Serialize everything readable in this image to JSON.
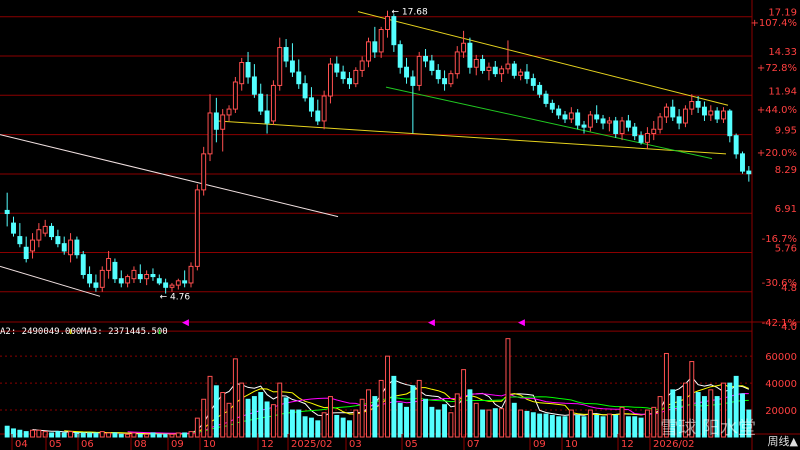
{
  "colors": {
    "up": "#ff5050",
    "down": "#54ffff",
    "grid": "#8b0000",
    "price_label": "#ff4040",
    "ma_colors": [
      "#ffffff",
      "#ffff00",
      "#ff00ff",
      "#00ff00"
    ],
    "trend_upper": "#e6d21e",
    "trend_lower": "#21c821",
    "trend_left": "#f0e0e0"
  },
  "labels": {
    "ma_readout_a": "A2: 2490049.000",
    "ma_readout_b": "MA3: 2371445.500",
    "arrow_a": "↓",
    "arrow_b": "↓",
    "high_marker": "17.68",
    "low_marker": "4.76",
    "watermark": "雪球 阳水堂",
    "period_button": "周线▲"
  },
  "chart_data": [
    {
      "type": "candlestick",
      "price_ticks": [
        17.19,
        14.33,
        11.94,
        9.95,
        8.29,
        6.91,
        5.76,
        4.8,
        4.0
      ],
      "percent_ticks": [
        "+107.4%",
        "+72.8%",
        "+44.0%",
        "+20.0%",
        "-16.7%",
        "-30.6%",
        "-42.1%"
      ],
      "x_ticks": [
        "04",
        "05",
        "06",
        "08",
        "09",
        "10",
        "12",
        "2025/02",
        "03",
        "05",
        "07",
        "09",
        "10",
        "12",
        "2026/02"
      ],
      "annotations": {
        "high": 17.68,
        "low": 4.76
      },
      "log_scale": true,
      "ohlc": [
        [
          7.0,
          7.6,
          6.5,
          6.9
        ],
        [
          6.6,
          6.8,
          6.2,
          6.3
        ],
        [
          6.2,
          6.6,
          5.9,
          6.0
        ],
        [
          5.9,
          6.2,
          5.5,
          5.6
        ],
        [
          5.8,
          6.3,
          5.6,
          6.1
        ],
        [
          6.1,
          6.6,
          5.9,
          6.4
        ],
        [
          6.3,
          6.7,
          6.2,
          6.5
        ],
        [
          6.5,
          6.6,
          6.1,
          6.2
        ],
        [
          6.2,
          6.4,
          5.9,
          6.0
        ],
        [
          6.0,
          6.2,
          5.7,
          5.8
        ],
        [
          5.7,
          6.3,
          5.5,
          6.1
        ],
        [
          6.1,
          6.2,
          5.6,
          5.7
        ],
        [
          5.7,
          5.8,
          5.1,
          5.2
        ],
        [
          5.2,
          5.4,
          4.9,
          5.0
        ],
        [
          5.0,
          5.2,
          4.8,
          4.9
        ],
        [
          4.9,
          5.4,
          4.8,
          5.3
        ],
        [
          5.3,
          5.8,
          5.1,
          5.6
        ],
        [
          5.5,
          5.6,
          5.0,
          5.1
        ],
        [
          5.1,
          5.3,
          4.9,
          5.0
        ],
        [
          5.0,
          5.2,
          4.9,
          5.15
        ],
        [
          5.1,
          5.4,
          5.0,
          5.3
        ],
        [
          5.2,
          5.45,
          5.0,
          5.1
        ],
        [
          5.1,
          5.3,
          4.95,
          5.2
        ],
        [
          5.2,
          5.35,
          5.05,
          5.15
        ],
        [
          5.1,
          5.2,
          4.95,
          5.0
        ],
        [
          5.0,
          5.1,
          4.76,
          4.9
        ],
        [
          4.9,
          5.0,
          4.8,
          4.95
        ],
        [
          4.95,
          5.1,
          4.85,
          5.05
        ],
        [
          5.05,
          5.3,
          4.9,
          5.0
        ],
        [
          5.0,
          5.5,
          4.9,
          5.4
        ],
        [
          5.4,
          7.9,
          5.3,
          7.7
        ],
        [
          7.7,
          9.4,
          7.5,
          9.1
        ],
        [
          9.1,
          12.0,
          8.8,
          11.0
        ],
        [
          11.0,
          11.8,
          9.6,
          10.2
        ],
        [
          10.2,
          11.2,
          9.2,
          10.9
        ],
        [
          10.9,
          11.4,
          10.6,
          11.2
        ],
        [
          11.2,
          13.0,
          11.0,
          12.7
        ],
        [
          12.6,
          14.2,
          12.2,
          13.9
        ],
        [
          13.9,
          14.6,
          12.6,
          13.0
        ],
        [
          13.0,
          13.8,
          11.8,
          12.0
        ],
        [
          12.0,
          12.6,
          10.9,
          11.1
        ],
        [
          11.1,
          12.0,
          10.0,
          10.5
        ],
        [
          10.6,
          12.8,
          10.4,
          12.5
        ],
        [
          12.5,
          15.6,
          12.2,
          14.9
        ],
        [
          14.9,
          15.5,
          13.6,
          14.0
        ],
        [
          14.0,
          15.2,
          13.0,
          13.3
        ],
        [
          13.3,
          14.1,
          12.3,
          12.6
        ],
        [
          12.6,
          13.1,
          11.6,
          11.8
        ],
        [
          11.8,
          12.4,
          10.8,
          11.1
        ],
        [
          11.1,
          11.7,
          10.4,
          10.6
        ],
        [
          10.6,
          12.2,
          10.2,
          11.9
        ],
        [
          11.9,
          14.2,
          11.5,
          13.8
        ],
        [
          13.8,
          14.3,
          13.0,
          13.3
        ],
        [
          13.3,
          13.7,
          12.6,
          12.9
        ],
        [
          12.9,
          13.3,
          12.3,
          12.6
        ],
        [
          12.6,
          13.6,
          12.4,
          13.4
        ],
        [
          13.4,
          14.3,
          13.0,
          14.0
        ],
        [
          14.0,
          15.6,
          13.6,
          15.3
        ],
        [
          15.3,
          16.4,
          14.2,
          14.6
        ],
        [
          14.6,
          16.4,
          14.2,
          16.2
        ],
        [
          16.2,
          17.68,
          15.6,
          17.2
        ],
        [
          17.2,
          17.4,
          14.6,
          15.1
        ],
        [
          15.1,
          15.4,
          13.2,
          13.6
        ],
        [
          13.6,
          14.2,
          12.6,
          13.0
        ],
        [
          13.0,
          13.4,
          10.0,
          12.5
        ],
        [
          12.5,
          14.6,
          12.2,
          14.3
        ],
        [
          14.3,
          14.8,
          13.6,
          14.0
        ],
        [
          14.0,
          14.4,
          13.1,
          13.4
        ],
        [
          13.4,
          13.8,
          12.6,
          12.9
        ],
        [
          12.9,
          13.4,
          12.2,
          12.6
        ],
        [
          12.6,
          13.4,
          12.4,
          13.2
        ],
        [
          13.2,
          15.0,
          12.9,
          14.6
        ],
        [
          14.6,
          16.1,
          14.2,
          15.2
        ],
        [
          15.2,
          15.6,
          13.2,
          13.6
        ],
        [
          13.6,
          14.4,
          13.1,
          14.1
        ],
        [
          14.1,
          14.4,
          13.2,
          13.4
        ],
        [
          13.4,
          13.9,
          12.8,
          13.6
        ],
        [
          13.6,
          14.0,
          13.0,
          13.2
        ],
        [
          13.2,
          13.7,
          12.7,
          13.5
        ],
        [
          13.5,
          15.4,
          13.2,
          13.8
        ],
        [
          13.8,
          14.0,
          12.9,
          13.1
        ],
        [
          13.1,
          13.5,
          12.8,
          13.3
        ],
        [
          13.3,
          13.8,
          12.6,
          12.9
        ],
        [
          12.9,
          13.2,
          12.2,
          12.5
        ],
        [
          12.5,
          12.7,
          11.8,
          12.0
        ],
        [
          12.0,
          12.2,
          11.3,
          11.5
        ],
        [
          11.5,
          11.7,
          11.0,
          11.2
        ],
        [
          11.2,
          11.4,
          10.7,
          10.9
        ],
        [
          10.9,
          11.1,
          10.5,
          10.7
        ],
        [
          10.7,
          11.3,
          10.5,
          11.0
        ],
        [
          11.0,
          11.2,
          10.2,
          10.4
        ],
        [
          10.4,
          10.6,
          10.0,
          10.3
        ],
        [
          10.3,
          11.1,
          10.1,
          10.9
        ],
        [
          10.9,
          11.4,
          10.5,
          10.7
        ],
        [
          10.7,
          10.9,
          10.2,
          10.5
        ],
        [
          10.5,
          10.8,
          10.1,
          10.6
        ],
        [
          10.6,
          10.8,
          9.8,
          10.0
        ],
        [
          10.0,
          10.8,
          9.7,
          10.6
        ],
        [
          10.6,
          10.9,
          10.1,
          10.3
        ],
        [
          10.3,
          10.5,
          9.7,
          9.9
        ],
        [
          9.9,
          10.1,
          9.5,
          9.6
        ],
        [
          9.6,
          10.3,
          9.3,
          10.0
        ],
        [
          10.0,
          10.6,
          9.7,
          10.2
        ],
        [
          10.2,
          11.0,
          10.0,
          10.8
        ],
        [
          10.8,
          11.5,
          10.5,
          11.3
        ],
        [
          11.3,
          11.7,
          10.6,
          10.8
        ],
        [
          10.8,
          11.2,
          10.2,
          10.5
        ],
        [
          10.5,
          11.4,
          10.3,
          11.2
        ],
        [
          11.2,
          12.0,
          10.9,
          11.6
        ],
        [
          11.6,
          11.9,
          11.0,
          11.3
        ],
        [
          11.3,
          11.6,
          10.6,
          10.9
        ],
        [
          10.9,
          11.4,
          10.6,
          11.1
        ],
        [
          11.1,
          11.3,
          10.5,
          10.7
        ],
        [
          10.7,
          11.3,
          10.5,
          11.1
        ],
        [
          11.1,
          11.2,
          9.6,
          9.9
        ],
        [
          9.9,
          10.0,
          8.9,
          9.1
        ],
        [
          9.1,
          9.2,
          8.3,
          8.4
        ],
        [
          8.4,
          8.6,
          8.0,
          8.3
        ]
      ]
    },
    {
      "type": "bar",
      "y_ticks": [
        20000,
        40000,
        60000
      ],
      "series": [
        {
          "name": "A2",
          "values": []
        },
        {
          "name": "MA3",
          "values": []
        }
      ],
      "values": [
        8,
        6,
        5,
        4,
        5,
        5,
        4,
        3,
        4,
        3,
        4,
        3,
        3,
        3,
        3,
        4,
        3,
        3,
        2,
        2,
        3,
        2,
        2,
        3,
        2,
        2,
        2,
        3,
        3,
        4,
        14,
        28,
        45,
        38,
        33,
        25,
        58,
        40,
        28,
        30,
        33,
        26,
        24,
        40,
        29,
        20,
        20,
        15,
        14,
        12,
        18,
        30,
        16,
        14,
        12,
        20,
        28,
        35,
        30,
        42,
        60,
        45,
        25,
        22,
        38,
        42,
        28,
        22,
        20,
        24,
        18,
        32,
        50,
        35,
        25,
        20,
        20,
        21,
        21,
        73,
        25,
        20,
        19,
        18,
        17,
        17,
        16,
        15,
        15,
        20,
        16,
        15,
        20,
        16,
        15,
        17,
        16,
        22,
        15,
        15,
        14,
        20,
        22,
        30,
        62,
        35,
        30,
        40,
        56,
        33,
        30,
        35,
        30,
        40,
        40,
        45,
        32,
        20
      ]
    }
  ]
}
